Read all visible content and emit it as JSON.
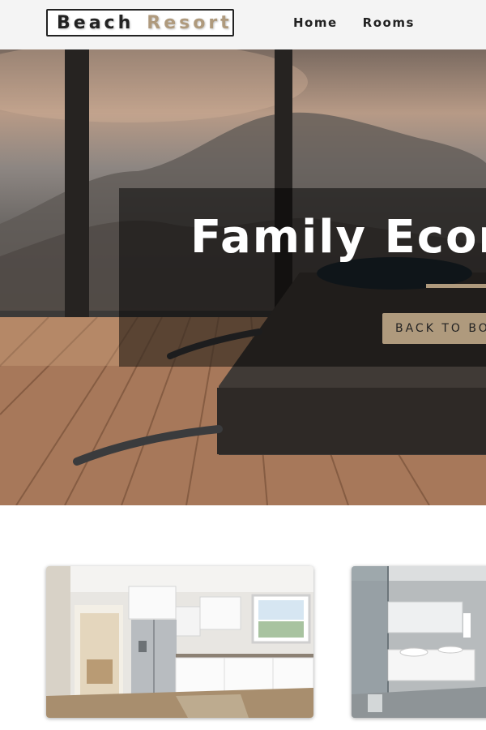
{
  "nav": {
    "logo_part1": "Beach",
    "logo_part2": "Resort",
    "links": [
      {
        "label": "Home"
      },
      {
        "label": "Rooms"
      }
    ]
  },
  "hero": {
    "title": "Family Econ",
    "button_label": "BACK TO BO"
  },
  "colors": {
    "accent": "#af9a7d",
    "text_dark": "#222222",
    "navbar_bg": "#f4f4f4"
  }
}
